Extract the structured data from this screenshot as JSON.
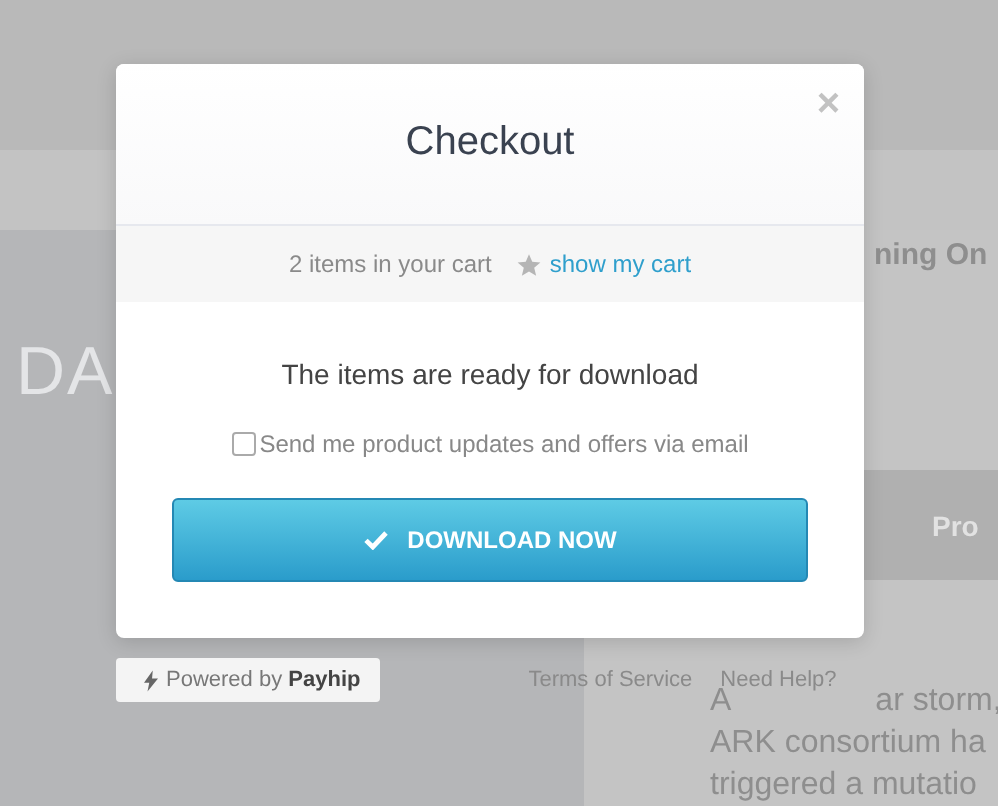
{
  "background": {
    "hero_text": "DA",
    "heading": "ning On",
    "button": "Pro",
    "paragraph_first": [
      "A",
      "ar storm,"
    ],
    "paragraph_lines": [
      "ARK consortium ha",
      "triggered a mutatio"
    ]
  },
  "modal": {
    "title": "Checkout",
    "close": "×",
    "cart_count": "2 items in your cart",
    "cart_link": "show my cart",
    "message": "The items are ready for download",
    "opt_in": {
      "label": "Send me product updates and offers via email",
      "checked": false
    },
    "button": "DOWNLOAD NOW"
  },
  "footer": {
    "powered_prefix": "Powered by",
    "powered_brand": "Payhip",
    "links": [
      "Terms of Service",
      "Need Help?"
    ]
  }
}
